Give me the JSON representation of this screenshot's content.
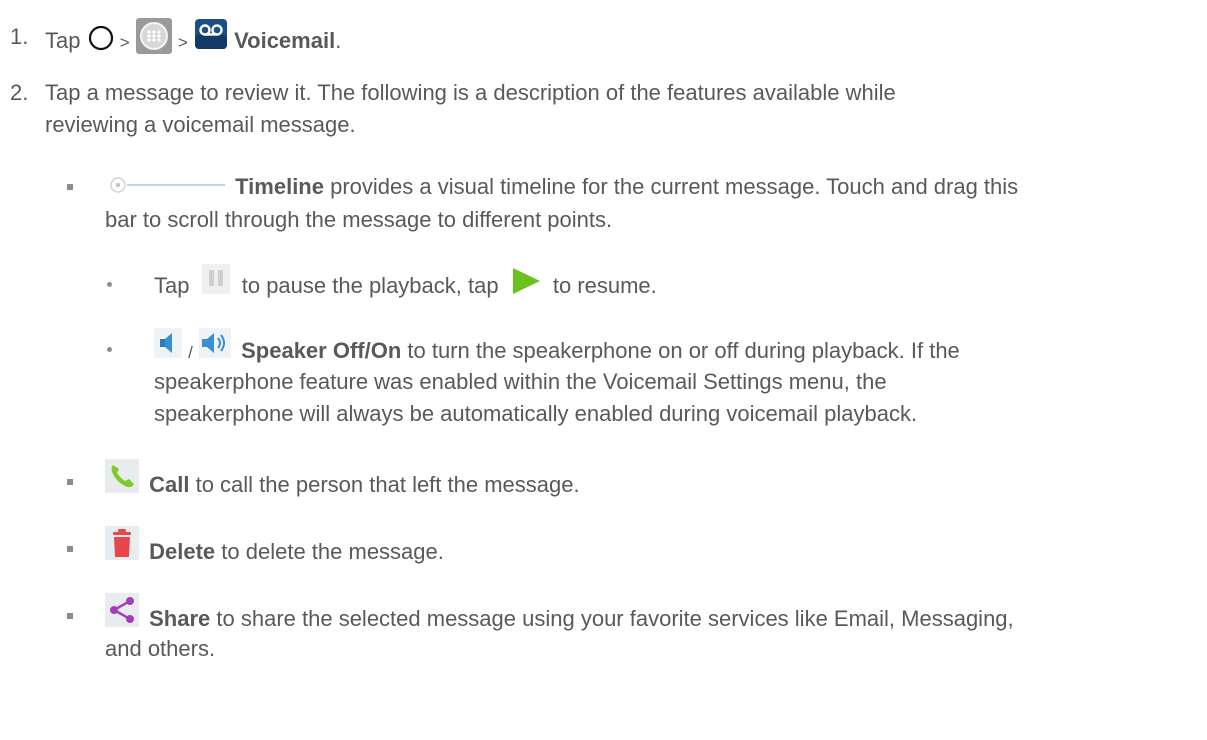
{
  "step1": {
    "number": "1.",
    "tap": "Tap",
    "sep1": ">",
    "sep2": ">",
    "voicemail": "Voicemail",
    "period": "."
  },
  "step2": {
    "number": "2.",
    "line1": "Tap a message to review it. The following is a description of the features available while",
    "line2": "reviewing a voicemail message."
  },
  "timeline": {
    "title": "Timeline",
    "text1": " provides a visual timeline for the current message. Touch and drag this",
    "text2": "bar to scroll through the message to different points."
  },
  "pause": {
    "tap": "Tap",
    "text1": "to pause the playback, tap",
    "text2": "to resume."
  },
  "speaker": {
    "slash": "/",
    "title": "Speaker Off/On",
    "text1": " to turn the speakerphone on or off during playback. If the",
    "text2": "speakerphone feature was enabled within the Voicemail Settings menu, the",
    "text3": "speakerphone will always be automatically enabled during voicemail playback."
  },
  "call": {
    "title": "Call",
    "text": " to call the person that left the message."
  },
  "delete": {
    "title": "Delete",
    "text": " to delete the message."
  },
  "share": {
    "title": "Share",
    "text1": " to share the selected message using your favorite services like Email, Messaging,",
    "text2": "and others."
  },
  "icons": {
    "home": "home-circle-icon",
    "apps": "apps-launcher-icon",
    "voicemail": "voicemail-app-icon",
    "timeline": "timeline-slider-icon",
    "pause": "pause-icon",
    "play": "play-icon",
    "speaker_off": "speaker-off-icon",
    "speaker_on": "speaker-on-icon",
    "call": "phone-call-icon",
    "delete": "trash-icon",
    "share": "share-icon"
  },
  "colors": {
    "text": "#595959",
    "play_green": "#6bc21e",
    "call_green": "#7ecb2a",
    "delete_red": "#e8464a",
    "share_purple": "#a23fb8",
    "speaker_blue": "#3a8fd0"
  }
}
